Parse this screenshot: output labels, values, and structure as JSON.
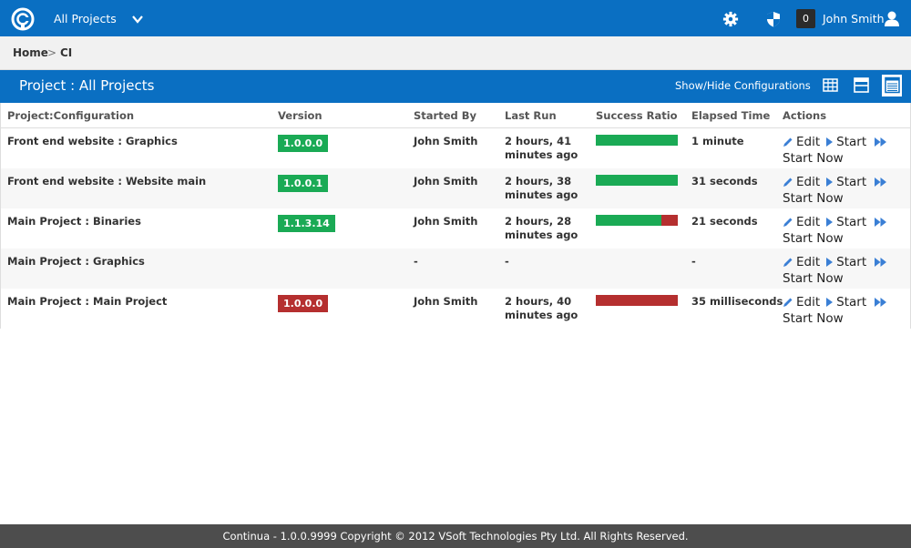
{
  "topbar": {
    "project_select": "All Projects",
    "notification_count": "0",
    "user_name": "John Smith",
    "bg_color": "#0a6fc2"
  },
  "breadcrumb": {
    "home": "Home",
    "separator": ">",
    "current": "CI"
  },
  "titlebar": {
    "title": "Project : All Projects",
    "show_hide": "Show/Hide Configurations"
  },
  "table": {
    "headers": {
      "project": "Project:Configuration",
      "version": "Version",
      "started_by": "Started By",
      "last_run": "Last Run",
      "success_ratio": "Success Ratio",
      "elapsed": "Elapsed Time",
      "actions": "Actions"
    },
    "rows": [
      {
        "project": "Front end website : Graphics",
        "version": "1.0.0.0",
        "version_status": "success",
        "started_by": "John Smith",
        "last_run": "2 hours, 41 minutes ago",
        "success_ratio": 1.0,
        "elapsed": "1 minute"
      },
      {
        "project": "Front end website : Website main",
        "version": "1.0.0.1",
        "version_status": "success",
        "started_by": "John Smith",
        "last_run": "2 hours, 38 minutes ago",
        "success_ratio": 1.0,
        "elapsed": "31 seconds"
      },
      {
        "project": "Main Project : Binaries",
        "version": "1.1.3.14",
        "version_status": "success",
        "started_by": "John Smith",
        "last_run": "2 hours, 28 minutes ago",
        "success_ratio": 0.8,
        "elapsed": "21 seconds"
      },
      {
        "project": "Main Project : Graphics",
        "version": "",
        "version_status": "none",
        "started_by": "-",
        "last_run": "-",
        "success_ratio": null,
        "elapsed": "-"
      },
      {
        "project": "Main Project : Main Project",
        "version": "1.0.0.0",
        "version_status": "failed",
        "started_by": "John Smith",
        "last_run": "2 hours, 40 minutes ago",
        "success_ratio": 0.0,
        "elapsed": "35 milliseconds"
      }
    ],
    "actions": {
      "edit": "Edit",
      "start": "Start",
      "start_now": "Start Now"
    }
  },
  "colors": {
    "success": "#1aaa55",
    "failed": "#b52f2f",
    "action_icon": "#3a7fd5"
  },
  "footer": {
    "text": "Continua - 1.0.0.9999 Copyright © 2012 VSoft Technologies Pty Ltd. All Rights Reserved."
  }
}
